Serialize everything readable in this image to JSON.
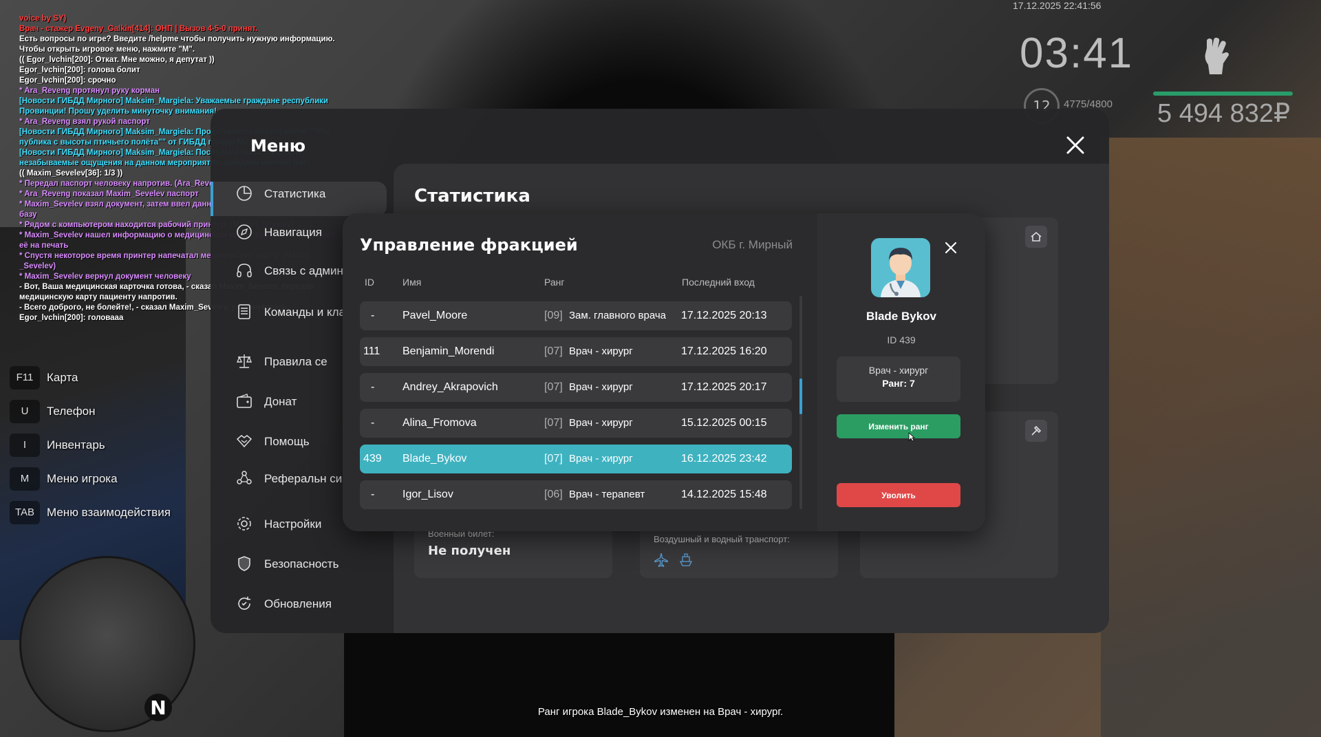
{
  "chat": [
    {
      "text": "voice by SY)",
      "color": "#ff3b3b"
    },
    {
      "text": "Врач - стажер Evgeny_Galkin[414]: ОНП | Вызов 4-5-0 принят.",
      "color": "#ff3b3b"
    },
    {
      "text": "Есть вопросы по игре? Введите /helpme чтобы получить нужную информацию.",
      "color": "#ffffff"
    },
    {
      "text": "Чтобы открыть игровое меню, нажмите \"M\".",
      "color": "#ffffff"
    },
    {
      "text": "(( Egor_lvchin[200]: Откат. Мне можно, я депутат ))",
      "color": "#ffffff"
    },
    {
      "text": "Egor_lvchin[200]: голова болит",
      "color": "#ffffff"
    },
    {
      "text": "Egor_lvchin[200]: срочно",
      "color": "#ffffff"
    },
    {
      "text": "* Ara_Reveng протянул руку корман",
      "color": "#d98cff"
    },
    {
      "text": "[Новости ГИБДД Мирного] Maksim_Margiela: Уважаемые граждане республики",
      "color": "#3fe0ff"
    },
    {
      "text": " Провинции! Прошу уделить минуточку внимания!",
      "color": "#3fe0ff"
    },
    {
      "text": "* Ara_Reveng взял рукой паспорт",
      "color": "#d98cff"
    },
    {
      "text": "[Новости ГИБДД Мирного] Maksim_Margiela: Продолжается мероприятие \"\"Рес",
      "color": "#3fe0ff"
    },
    {
      "text": "публика с высоты птичьего полёта\"\" от ГИБДД города Мирный!",
      "color": "#3fe0ff"
    },
    {
      "text": "[Новости ГИБДД Мирного] Maksim_Margiela: Последний шанс получить",
      "color": "#3fe0ff"
    },
    {
      "text": "незабываемые ощущения на данном мероприятии, ожидаем именно Вас!",
      "color": "#3fe0ff"
    },
    {
      "text": "(( Maxim_Sevelev[36]: 1/3 ))",
      "color": "#ffffff"
    },
    {
      "text": " * Передал паспорт человеку напротив. (Ara_Reveng)",
      "color": "#d98cff"
    },
    {
      "text": " * Ara_Reveng показал Maxim_Sevelev паспорт",
      "color": "#d98cff"
    },
    {
      "text": " * Maxim_Sevelev взял документ, затем ввел данные о пациенте в медицинскую",
      "color": "#d98cff"
    },
    {
      "text": " базу",
      "color": "#d98cff"
    },
    {
      "text": " * Рядом с компьютером находится рабочий принтер. (Maxim_Sevelev)",
      "color": "#d98cff"
    },
    {
      "text": " * Maxim_Sevelev нашел информацию о медицинской карте пациента и отправил",
      "color": "#d98cff"
    },
    {
      "text": " её на печать",
      "color": "#d98cff"
    },
    {
      "text": " * Спустя некоторое время принтер напечатал медицинскую карту. (Maxim",
      "color": "#d98cff"
    },
    {
      "text": " _Sevelev)",
      "color": "#d98cff"
    },
    {
      "text": " * Maxim_Sevelev вернул документ человеку",
      "color": "#d98cff"
    },
    {
      "text": " - Вот, Ваша медицинская карточка готова, - сказал Maxim_Sevelev, передав",
      "color": "#ffffff"
    },
    {
      "text": " медицинскую карту пациенту напротив.",
      "color": "#ffffff"
    },
    {
      "text": " - Всего доброго, не болейте!, - сказал Maxim_Sevelev, улыбнувшись.",
      "color": "#ffffff"
    },
    {
      "text": "Egor_lvchin[200]: головааа",
      "color": "#ffffff"
    }
  ],
  "hotkeys": [
    {
      "key": "F11",
      "label": "Карта"
    },
    {
      "key": "U",
      "label": "Телефон"
    },
    {
      "key": "I",
      "label": "Инвентарь"
    },
    {
      "key": "M",
      "label": "Меню игрока"
    },
    {
      "key": "TAB",
      "label": "Меню взаимодействия"
    }
  ],
  "minimap": {
    "north": "N"
  },
  "hud": {
    "date": "17.12.2025 22:41:56",
    "time": "03:41",
    "level": "12",
    "exp": "4775/4800",
    "exp_progress": 0.995,
    "money": "5 494 832₽"
  },
  "menu": {
    "title": "Меню",
    "nav": [
      {
        "label": "Статистика",
        "icon": "chart-icon"
      },
      {
        "label": "Навигация",
        "icon": "compass-icon"
      },
      {
        "label": "Связь с администрс",
        "icon": "headset-icon"
      },
      {
        "label": "Команды и клавиши",
        "icon": "list-icon"
      },
      {
        "label": "Правила се",
        "icon": "scales-icon"
      },
      {
        "label": "Донат",
        "icon": "wallet-icon"
      },
      {
        "label": "Помощь",
        "icon": "handshake-icon"
      },
      {
        "label": "Реферальн система",
        "icon": "people-icon"
      },
      {
        "label": "Настройки",
        "icon": "gear-icon"
      },
      {
        "label": "Безопасность",
        "icon": "shield-icon"
      },
      {
        "label": "Обновления",
        "icon": "refresh-icon"
      }
    ],
    "content_title": "Статистика",
    "cards": {
      "military_label": "Военный билет:",
      "military_value": "Не получен",
      "transport_label": "Воздушный и водный транспорт:"
    }
  },
  "faction": {
    "title": "Управление фракцией",
    "org": "ОКБ г. Мирный",
    "headers": {
      "id": "ID",
      "name": "Имя",
      "rank": "Ранг",
      "last": "Последний вход"
    },
    "rows": [
      {
        "id": "-",
        "name": "Pavel_Moore",
        "rank_num": "[09]",
        "rank": "Зам. главного врача",
        "last": "17.12.2025 20:13"
      },
      {
        "id": "111",
        "name": "Benjamin_Morendi",
        "rank_num": "[07]",
        "rank": "Врач - хирург",
        "last": "17.12.2025 16:20"
      },
      {
        "id": "-",
        "name": "Andrey_Akrapovich",
        "rank_num": "[07]",
        "rank": "Врач - хирург",
        "last": "17.12.2025 20:17"
      },
      {
        "id": "-",
        "name": "Alina_Fromova",
        "rank_num": "[07]",
        "rank": "Врач - хирург",
        "last": "15.12.2025 00:15"
      },
      {
        "id": "439",
        "name": "Blade_Bykov",
        "rank_num": "[07]",
        "rank": "Врач - хирург",
        "last": "16.12.2025 23:42"
      },
      {
        "id": "-",
        "name": "Igor_Lisov",
        "rank_num": "[06]",
        "rank": "Врач - терапевт",
        "last": "14.12.2025 15:48"
      }
    ],
    "selected_index": 4,
    "player": {
      "name": "Blade Bykov",
      "id": "ID 439",
      "position": "Врач - хирург",
      "rank": "Ранг: 7",
      "change_rank": "Изменить ранг",
      "fire": "Уволить"
    }
  },
  "notice": "Ранг игрока Blade_Bykov изменен на Врач - хирург."
}
